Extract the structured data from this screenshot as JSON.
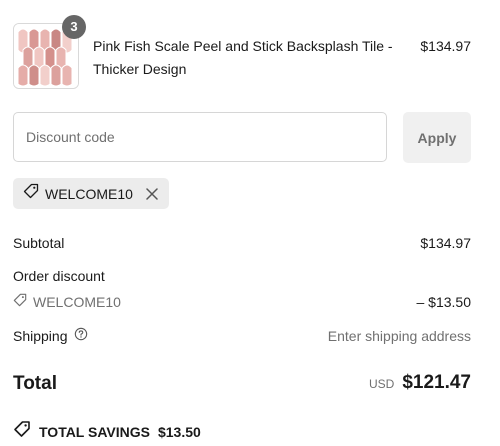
{
  "product": {
    "name": "Pink Fish Scale Peel and Stick Backsplash Tile - Thicker Design",
    "price": "$134.97",
    "quantity": "3"
  },
  "discount": {
    "placeholder": "Discount code",
    "apply_label": "Apply",
    "applied_code": "WELCOME10"
  },
  "summary": {
    "subtotal_label": "Subtotal",
    "subtotal_value": "$134.97",
    "order_discount_label": "Order discount",
    "discount_code": "WELCOME10",
    "discount_value": "– $13.50",
    "shipping_label": "Shipping",
    "shipping_value": "Enter shipping address",
    "total_label": "Total",
    "currency": "USD",
    "total_value": "$121.47",
    "savings_label": "TOTAL SAVINGS",
    "savings_value": "$13.50"
  },
  "colors": {
    "text": "#1a1a1a",
    "muted": "#707070",
    "chip_bg": "#ececec",
    "button_bg": "#f0f0f0",
    "badge_bg": "#666666",
    "tile_pink": "#e8b4b0"
  },
  "icons": {
    "tag": "tag-icon",
    "close": "close-icon",
    "help": "help-circle-icon",
    "savings": "savings-tag-icon"
  }
}
